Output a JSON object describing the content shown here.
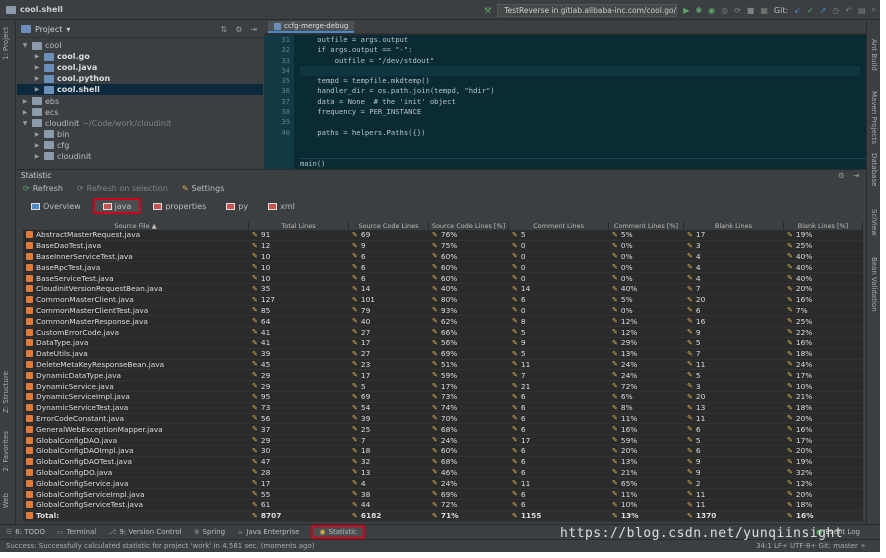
{
  "app": {
    "project_title": "cool.shell"
  },
  "toolbar": {
    "run_config": "TestReverse in gitlab.alibaba-inc.com/cool.go/stringutil",
    "git_label": "Git:"
  },
  "left_strip": {
    "project_tab": "1: Project",
    "structure_tab": "Z: Structure",
    "favorites_tab": "2: Favorites",
    "web_tab": "Web"
  },
  "right_strip": {
    "ant_tab": "Ant Build",
    "maven_tab": "Maven Projects",
    "database_tab": "Database",
    "sciview_tab": "SciView",
    "bean_tab": "Bean Validation"
  },
  "project_panel": {
    "title": "Project",
    "tree": [
      {
        "label": "cool",
        "level": 0,
        "open": true,
        "bold": false,
        "extra": ""
      },
      {
        "label": "cool.go",
        "level": 1,
        "open": false,
        "bold": true,
        "extra": ""
      },
      {
        "label": "cool.java",
        "level": 1,
        "open": false,
        "bold": true,
        "extra": ""
      },
      {
        "label": "cool.python",
        "level": 1,
        "open": false,
        "bold": true,
        "extra": ""
      },
      {
        "label": "cool.shell",
        "level": 1,
        "open": false,
        "bold": true,
        "extra": "",
        "selected": true
      },
      {
        "label": "ebs",
        "level": 0,
        "open": false,
        "bold": false,
        "extra": ""
      },
      {
        "label": "ecs",
        "level": 0,
        "open": false,
        "bold": false,
        "extra": ""
      },
      {
        "label": "cloudinit",
        "level": 0,
        "open": true,
        "bold": false,
        "extra": "~/Code/work/cloudinit"
      },
      {
        "label": "bin",
        "level": 1,
        "open": false,
        "bold": false,
        "extra": ""
      },
      {
        "label": "cfg",
        "level": 1,
        "open": false,
        "bold": false,
        "extra": ""
      },
      {
        "label": "cloudinit",
        "level": 1,
        "open": false,
        "bold": false,
        "extra": ""
      }
    ]
  },
  "editor": {
    "tab": "ccfg-merge-debug",
    "line_numbers": [
      "31",
      "32",
      "33",
      "34",
      "35",
      "36",
      "37",
      "38",
      "39",
      "40"
    ],
    "lines": [
      "    outfile = args.output",
      "    if args.output == \"-\":",
      "        outfile = \"/dev/stdout\"",
      "",
      "    tempd = tempfile.mkdtemp()",
      "    handler_dir = os.path.join(tempd, \"hdir\")",
      "    data = None  # the 'init' object",
      "    frequency = PER_INSTANCE",
      "",
      "    paths = helpers.Paths({})"
    ],
    "breadcrumb": "main()"
  },
  "statistic": {
    "title": "Statistic",
    "refresh": "Refresh",
    "refresh_on_selection": "Refresh on selection",
    "settings": "Settings",
    "tabs": [
      "Overview",
      "java",
      "properties",
      "py",
      "xml"
    ],
    "columns": [
      "Source File ▲",
      "Total Lines",
      "Source Code Lines",
      "Source Code Lines [%]",
      "Comment Lines",
      "Comment Lines [%]",
      "Blank Lines",
      "Blank Lines [%]"
    ],
    "rows": [
      [
        "AbstractMasterRequest.java",
        "91",
        "69",
        "76%",
        "5",
        "5%",
        "17",
        "19%"
      ],
      [
        "BaseDaoTest.java",
        "12",
        "9",
        "75%",
        "0",
        "0%",
        "3",
        "25%"
      ],
      [
        "BaseInnerServiceTest.java",
        "10",
        "6",
        "60%",
        "0",
        "0%",
        "4",
        "40%"
      ],
      [
        "BaseRpcTest.java",
        "10",
        "6",
        "60%",
        "0",
        "0%",
        "4",
        "40%"
      ],
      [
        "BaseServiceTest.java",
        "10",
        "6",
        "60%",
        "0",
        "0%",
        "4",
        "40%"
      ],
      [
        "CloudinitVersionRequestBean.java",
        "35",
        "14",
        "40%",
        "14",
        "40%",
        "7",
        "20%"
      ],
      [
        "CommonMasterClient.java",
        "127",
        "101",
        "80%",
        "6",
        "5%",
        "20",
        "16%"
      ],
      [
        "CommonMasterClientTest.java",
        "85",
        "79",
        "93%",
        "0",
        "0%",
        "6",
        "7%"
      ],
      [
        "CommonMasterResponse.java",
        "64",
        "40",
        "62%",
        "8",
        "12%",
        "16",
        "25%"
      ],
      [
        "CustomErrorCode.java",
        "41",
        "27",
        "66%",
        "5",
        "12%",
        "9",
        "22%"
      ],
      [
        "DataType.java",
        "41",
        "17",
        "56%",
        "9",
        "29%",
        "5",
        "16%"
      ],
      [
        "DateUtils.java",
        "39",
        "27",
        "69%",
        "5",
        "13%",
        "7",
        "18%"
      ],
      [
        "DeleteMetaKeyResponseBean.java",
        "45",
        "23",
        "51%",
        "11",
        "24%",
        "11",
        "24%"
      ],
      [
        "DynamicDataType.java",
        "29",
        "17",
        "59%",
        "7",
        "24%",
        "5",
        "17%"
      ],
      [
        "DynamicService.java",
        "29",
        "5",
        "17%",
        "21",
        "72%",
        "3",
        "10%"
      ],
      [
        "DynamicServiceImpl.java",
        "95",
        "69",
        "73%",
        "6",
        "6%",
        "20",
        "21%"
      ],
      [
        "DynamicServiceTest.java",
        "73",
        "54",
        "74%",
        "6",
        "8%",
        "13",
        "18%"
      ],
      [
        "ErrorCodeConstant.java",
        "56",
        "39",
        "70%",
        "6",
        "11%",
        "11",
        "20%"
      ],
      [
        "GeneralWebExceptionMapper.java",
        "37",
        "25",
        "68%",
        "6",
        "16%",
        "6",
        "16%"
      ],
      [
        "GlobalConfigDAO.java",
        "29",
        "7",
        "24%",
        "17",
        "59%",
        "5",
        "17%"
      ],
      [
        "GlobalConfigDAOImpl.java",
        "30",
        "18",
        "60%",
        "6",
        "20%",
        "6",
        "20%"
      ],
      [
        "GlobalConfigDAOTest.java",
        "47",
        "32",
        "68%",
        "6",
        "13%",
        "9",
        "19%"
      ],
      [
        "GlobalConfigDO.java",
        "28",
        "13",
        "46%",
        "6",
        "21%",
        "9",
        "32%"
      ],
      [
        "GlobalConfigService.java",
        "17",
        "4",
        "24%",
        "11",
        "65%",
        "2",
        "12%"
      ],
      [
        "GlobalConfigServiceImpl.java",
        "55",
        "38",
        "69%",
        "6",
        "11%",
        "11",
        "20%"
      ],
      [
        "GlobalConfigServiceTest.java",
        "61",
        "44",
        "72%",
        "6",
        "10%",
        "11",
        "18%"
      ]
    ],
    "total": [
      "Total:",
      "8707",
      "6182",
      "71%",
      "1155",
      "13%",
      "1370",
      "16%"
    ]
  },
  "bottom_tools": [
    "6: TODO",
    "Terminal",
    "9: Version Control",
    "Spring",
    "Java Enterprise",
    "Statistic"
  ],
  "event_log": "Event Log",
  "status": {
    "message": "Success: Successfully calculated statistic for project 'work' in 4.581 sec. (moments ago)",
    "right": "34:1  LF÷  UTF-8÷  Git: master ÷"
  },
  "watermark": "https://blog.csdn.net/yunqiinsight"
}
